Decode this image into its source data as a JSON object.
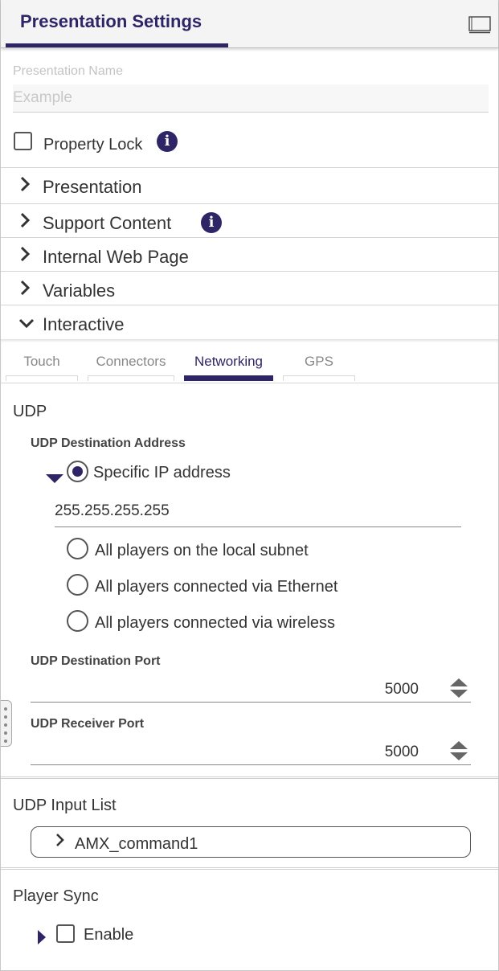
{
  "header": {
    "title": "Presentation Settings"
  },
  "name_field": {
    "label": "Presentation Name",
    "placeholder": "Example",
    "value": ""
  },
  "property_lock": {
    "label": "Property Lock",
    "checked": false
  },
  "accordion": [
    {
      "label": "Presentation",
      "expanded": false,
      "info": false
    },
    {
      "label": "Support Content",
      "expanded": false,
      "info": true
    },
    {
      "label": "Internal Web Page",
      "expanded": false,
      "info": false
    },
    {
      "label": "Variables",
      "expanded": false,
      "info": false
    },
    {
      "label": "Interactive",
      "expanded": true,
      "info": false
    }
  ],
  "tabs": [
    {
      "label": "Touch",
      "active": false
    },
    {
      "label": "Connectors",
      "active": false
    },
    {
      "label": "Networking",
      "active": true
    },
    {
      "label": "GPS",
      "active": false
    }
  ],
  "udp": {
    "title": "UDP",
    "dest_address_label": "UDP Destination Address",
    "options": [
      {
        "label": "Specific IP address",
        "selected": true
      },
      {
        "label": "All players on the local subnet",
        "selected": false
      },
      {
        "label": "All players connected via Ethernet",
        "selected": false
      },
      {
        "label": "All players connected via wireless",
        "selected": false
      }
    ],
    "ip_value": "255.255.255.255",
    "dest_port_label": "UDP Destination Port",
    "dest_port_value": "5000",
    "receiver_port_label": "UDP Receiver Port",
    "receiver_port_value": "5000"
  },
  "udp_input_list": {
    "title": "UDP Input List",
    "items": [
      {
        "label": "AMX_command1"
      }
    ]
  },
  "player_sync": {
    "title": "Player Sync",
    "enable_label": "Enable",
    "enabled": false
  },
  "colors": {
    "accent": "#2e2566",
    "text": "#333333",
    "border": "#d4d4d4"
  }
}
